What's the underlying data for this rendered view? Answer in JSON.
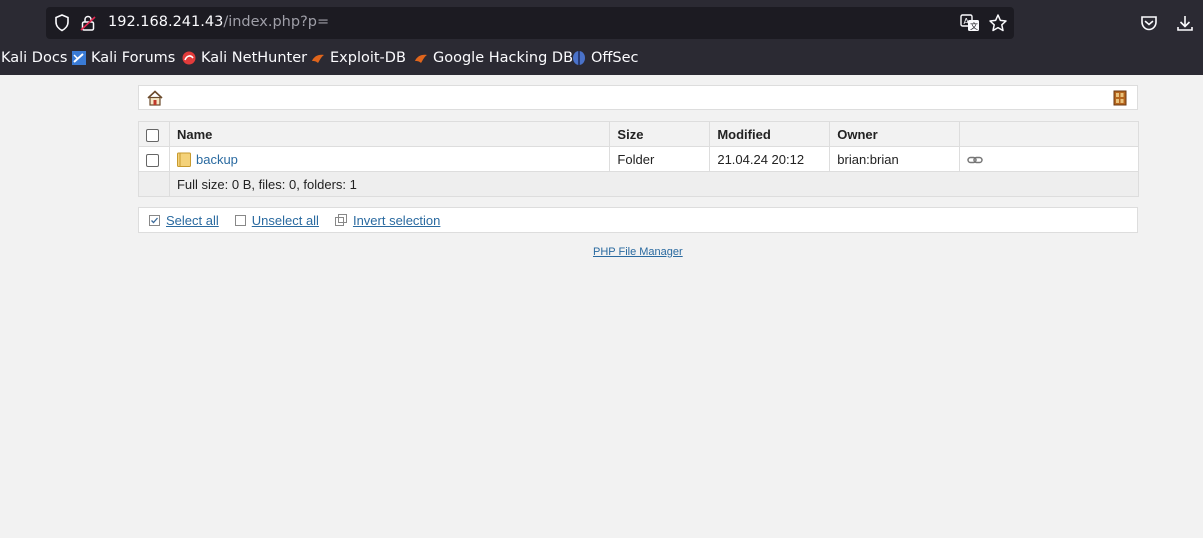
{
  "browser": {
    "url_host": "192.168.241.43",
    "url_path": "/index.php?p=",
    "bookmarks": [
      "Kali Docs",
      "Kali Forums",
      "Kali NetHunter",
      "Exploit-DB",
      "Google Hacking DB",
      "OffSec"
    ]
  },
  "file_manager": {
    "columns": [
      "Name",
      "Size",
      "Modified",
      "Owner"
    ],
    "rows": [
      {
        "name": "backup",
        "size": "Folder",
        "modified": "21.04.24 20:12",
        "owner": "brian:brian"
      }
    ],
    "summary": "Full size: 0 B, files: 0, folders: 1",
    "actions": {
      "select_all": "Select all",
      "unselect_all": "Unselect all",
      "invert": "Invert selection"
    },
    "footer": "PHP File Manager"
  }
}
